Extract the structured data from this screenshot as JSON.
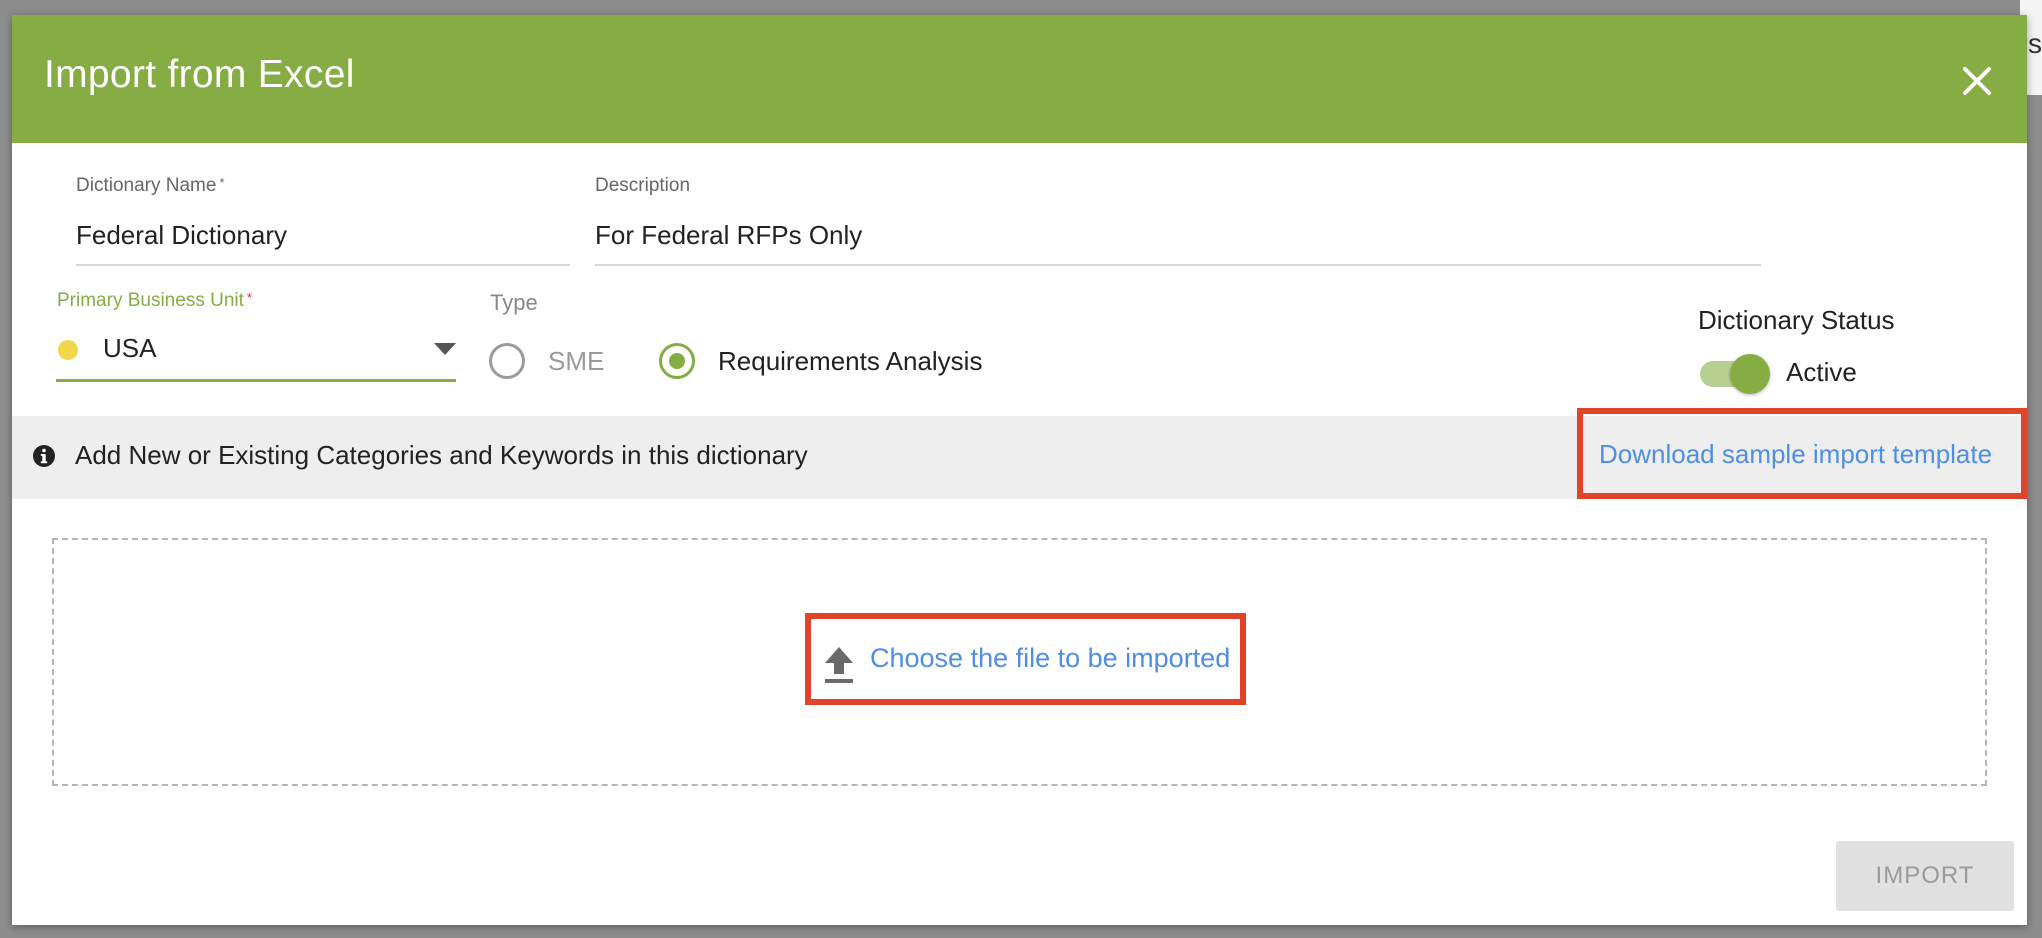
{
  "dialog": {
    "title": "Import from Excel",
    "close_icon": "close-icon",
    "header_color": "#86ad44"
  },
  "form": {
    "dictionary_name": {
      "label": "Dictionary Name",
      "required_mark": "*",
      "value": "Federal Dictionary"
    },
    "description": {
      "label": "Description",
      "value": "For Federal RFPs Only"
    },
    "primary_business_unit": {
      "label": "Primary Business Unit",
      "required_mark": "*",
      "value": "USA",
      "dot_color": "#f0d84a"
    },
    "type": {
      "label": "Type",
      "options": [
        {
          "label": "SME",
          "selected": false
        },
        {
          "label": "Requirements Analysis",
          "selected": true
        }
      ]
    },
    "dictionary_status": {
      "label": "Dictionary Status",
      "toggle_label": "Active",
      "active": true
    }
  },
  "info_bar": {
    "icon": "info-icon",
    "text": "Add New or Existing Categories and Keywords in this dictionary",
    "download_link": "Download sample import template"
  },
  "dropzone": {
    "icon": "upload-icon",
    "choose_label": "Choose the file to be imported"
  },
  "footer": {
    "import_label": "IMPORT",
    "import_enabled": false
  },
  "colors": {
    "accent": "#86ad44",
    "link": "#4f8ee6",
    "highlight": "#e2442a"
  },
  "background": {
    "edge_glyph": "s"
  }
}
